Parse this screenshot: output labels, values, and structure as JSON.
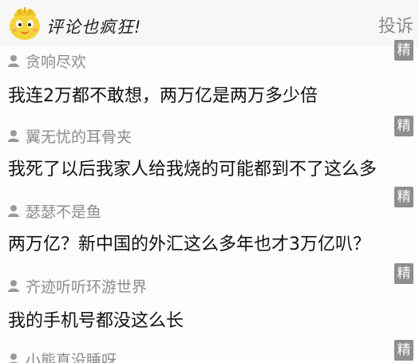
{
  "header": {
    "title": "评论也疯狂!",
    "action": "投诉"
  },
  "comments": [
    {
      "username": "贪响尽欢",
      "text": "我连2万都不敢想，两万亿是两万多少倍",
      "badge": "精"
    },
    {
      "username": "翼无忧的耳骨夹",
      "text": "我死了以后我家人给我烧的可能都到不了这么多",
      "badge": "精"
    },
    {
      "username": "瑟瑟不是鱼",
      "text": "两万亿？新中国的外汇这么多年也才3万亿叭？",
      "badge": "精"
    },
    {
      "username": "齐迹听听环游世界",
      "text": "我的手机号都没这么长",
      "badge": "精"
    },
    {
      "username": "小熊真没睡呀",
      "text": "",
      "badge": "精"
    }
  ],
  "icons": {
    "mascot": "chick-mascot-icon",
    "user": "user-icon"
  }
}
